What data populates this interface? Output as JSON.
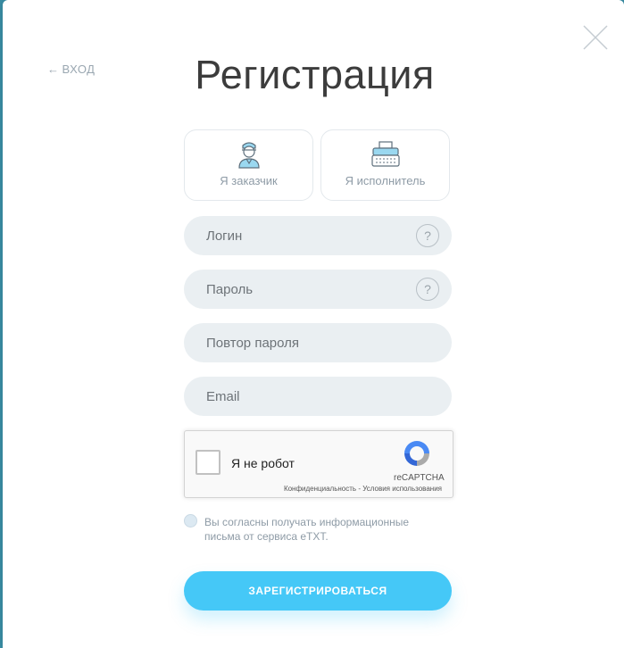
{
  "modal": {
    "back_link": "вход",
    "title": "Регистрация",
    "roles": [
      {
        "label": "Я заказчик",
        "icon": "customer-icon"
      },
      {
        "label": "Я исполнитель",
        "icon": "typewriter-icon"
      }
    ],
    "fields": {
      "login": {
        "placeholder": "Логин",
        "help": "?"
      },
      "password": {
        "placeholder": "Пароль",
        "help": "?"
      },
      "password_repeat": {
        "placeholder": "Повтор пароля"
      },
      "email": {
        "placeholder": "Email"
      }
    },
    "captcha": {
      "label": "Я не робот",
      "brand": "reCAPTCHA",
      "privacy": "Конфиденциальность",
      "separator": " - ",
      "terms": "Условия использования"
    },
    "consent": "Вы согласны получать информационные письма от сервиса eTXT.",
    "submit": "ЗАРЕГИСТРИРОВАТЬСЯ"
  },
  "colors": {
    "accent": "#45c8f7",
    "field_bg": "#eaeff2",
    "muted_text": "#8e9ba6"
  }
}
